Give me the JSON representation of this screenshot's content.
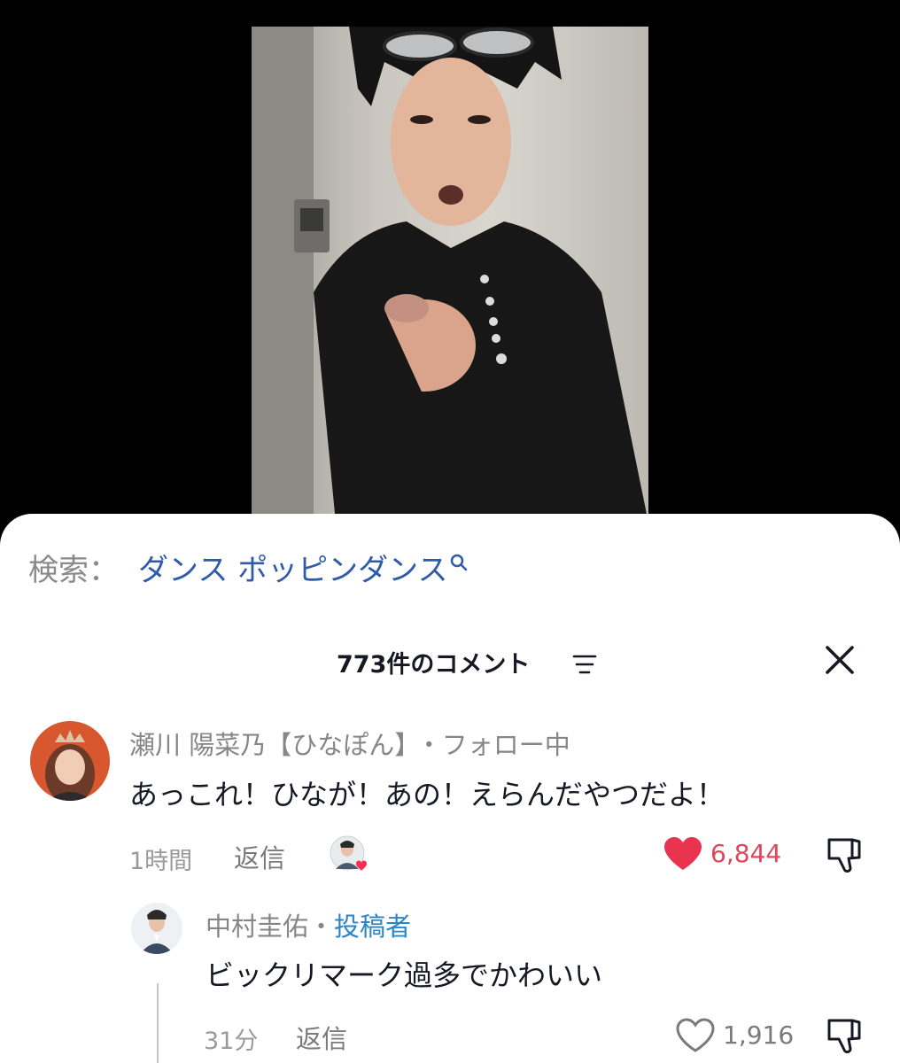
{
  "search": {
    "prefix": "検索：",
    "query": "ダンス ポッピンダンス"
  },
  "comments_header": {
    "count_label": "773件のコメント"
  },
  "comments": [
    {
      "author": "瀬川 陽菜乃【ひなぽん】",
      "separator": "・",
      "badge": "フォロー中",
      "text": "あっこれ！ひなが！あの！えらんだやつだよ！",
      "time": "1時間",
      "reply_label": "返信",
      "likes": "6,844",
      "liked": true
    }
  ],
  "replies": [
    {
      "author": "中村圭佑",
      "separator": "・",
      "badge": "投稿者",
      "text": "ビックリマーク過多でかわいい",
      "time": "31分",
      "reply_label": "返信",
      "likes": "1,916",
      "liked": false
    }
  ],
  "colors": {
    "accent_like": "#fe2c55",
    "link_blue": "#2f5ba8",
    "author_badge": "#2a86c7"
  },
  "icons": {
    "search": "search-icon",
    "filter": "filter-icon",
    "close": "close-icon",
    "heart": "heart-icon",
    "dislike": "thumbs-down-icon"
  }
}
